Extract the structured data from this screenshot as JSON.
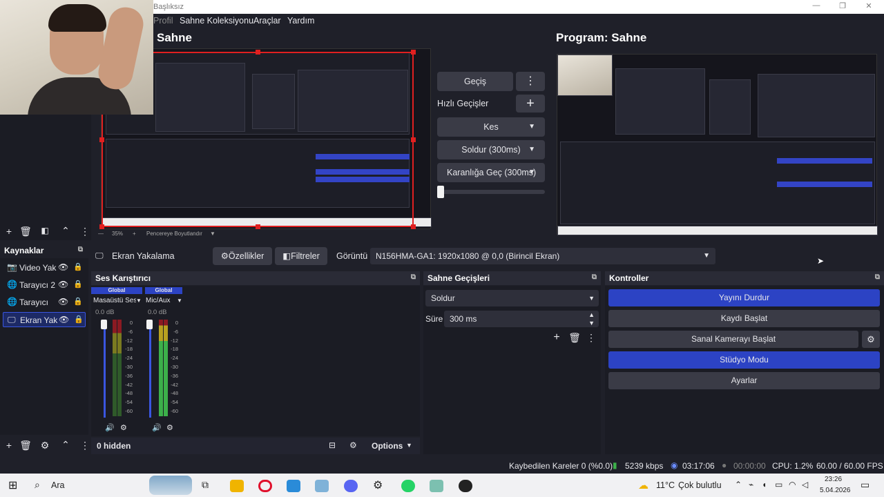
{
  "window": {
    "title": "Başlıksız",
    "controls": [
      "—",
      "❐",
      "✕"
    ]
  },
  "menu": [
    "Profil",
    "Sahne Koleksiyonu",
    "Araçlar",
    "Yardım"
  ],
  "preview": {
    "title": "Sahne",
    "zoom": "35%",
    "resize_label": "Pencereye Boyutlandır"
  },
  "program": {
    "title": "Program: Sahne"
  },
  "transitions_center": {
    "gecis": "Geçiş",
    "quick": "Hızlı Geçişler",
    "buttons": [
      "Kes",
      "Soldur (300ms)",
      "Karanlığa Geç (300ms)"
    ]
  },
  "sources": {
    "title": "Kaynaklar",
    "items": [
      {
        "name": "Video Yak",
        "icon": "camera-icon"
      },
      {
        "name": "Tarayıcı 2",
        "icon": "globe-icon"
      },
      {
        "name": "Tarayıcı",
        "icon": "globe-icon"
      },
      {
        "name": "Ekran Yak",
        "icon": "monitor-icon",
        "selected": true
      }
    ]
  },
  "context_bar": {
    "source": "Ekran Yakalama",
    "properties": "Özellikler",
    "filters": "Filtreler",
    "display_label": "Görüntü",
    "display_value": "N156HMA-GA1: 1920x1080 @ 0,0 (Birincil Ekran)"
  },
  "mixer": {
    "title": "Ses Karıştırıcı",
    "channels": [
      {
        "badge": "Global",
        "name": "Masaüstü Ses",
        "db": "0.0 dB"
      },
      {
        "badge": "Global",
        "name": "Mic/Aux",
        "db": "0.0 dB"
      }
    ],
    "scale": [
      "0",
      "-6",
      "-12",
      "-18",
      "-24",
      "-30",
      "-36",
      "-42",
      "-48",
      "-54",
      "-60"
    ],
    "hidden": "0 hidden",
    "options": "Options"
  },
  "scene_transitions": {
    "title": "Sahne Geçişleri",
    "selected": "Soldur",
    "duration_label": "Süre",
    "duration_value": "300 ms"
  },
  "controls": {
    "title": "Kontroller",
    "buttons": [
      "Yayını Durdur",
      "Kaydı Başlat",
      "Sanal Kamerayı Başlat",
      "Stüdyo Modu",
      "Ayarlar"
    ]
  },
  "status": {
    "dropped": "Kaybedilen Kareler 0 (%0.0)",
    "bitrate": "5239 kbps",
    "stream_time": "03:17:06",
    "rec_time": "00:00:00",
    "cpu": "CPU: 1.2%",
    "fps": "60.00 / 60.00 FPS"
  },
  "taskbar": {
    "search": "Ara",
    "weather": "11°C",
    "weather_desc": "Çok bulutlu",
    "time": "23:26",
    "date": "5.04.2026"
  },
  "colors": {
    "accent": "#2c43c4",
    "panel": "#2a2b36",
    "bg": "#1f2029",
    "selection_border": "#e02020"
  }
}
